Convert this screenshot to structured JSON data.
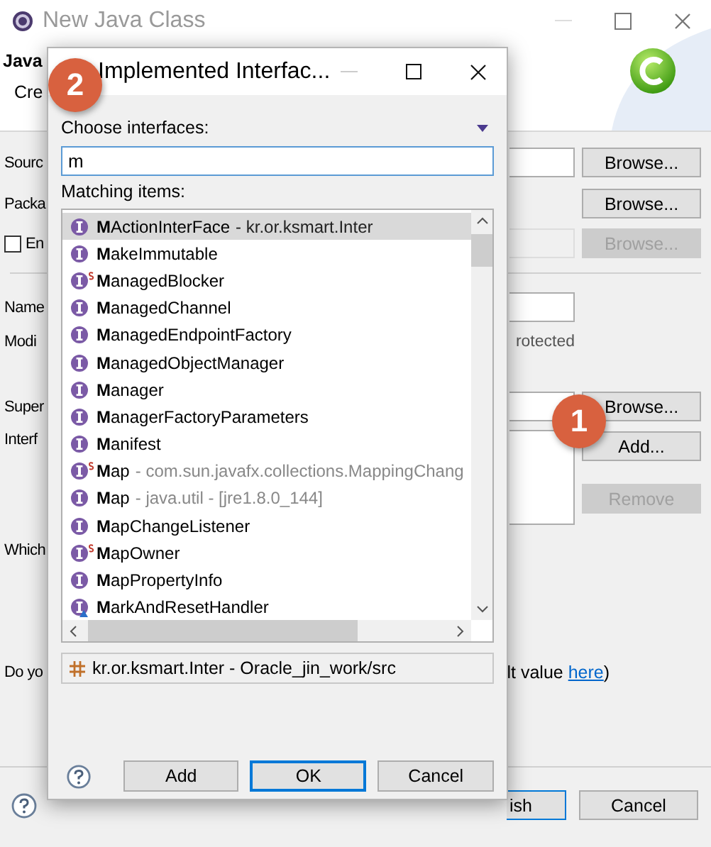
{
  "window": {
    "title": "New Java Class"
  },
  "header": {
    "title": "Java",
    "subtitle": "Cre"
  },
  "form": {
    "source_folder": {
      "label": "Sourc",
      "browse": {
        "label": "Browse...",
        "disabled": false
      }
    },
    "package": {
      "label": "Packa",
      "browse": {
        "label": "Browse...",
        "disabled": false
      }
    },
    "enclosing_type": {
      "label": "En",
      "checked": false,
      "browse": {
        "label": "Browse...",
        "disabled": true
      }
    },
    "name": {
      "label": "Name"
    },
    "modifiers": {
      "label": "Modi",
      "option": "rotected"
    },
    "superclass": {
      "label": "Super",
      "browse": {
        "label": "Browse...",
        "disabled": false
      }
    },
    "interfaces": {
      "label": "Interf",
      "add": {
        "label": "Add...",
        "disabled": false
      },
      "remove": {
        "label": "Remove",
        "disabled": true
      }
    },
    "stubs": {
      "label": "Which"
    },
    "comments": {
      "label": "Do yo",
      "text": "lt value",
      "link": "here",
      "after": ")"
    }
  },
  "footer": {
    "finish": "ish",
    "cancel": "Cancel"
  },
  "dialog": {
    "title": "Implemented Interfac...",
    "prompt": "Choose interfaces:",
    "filter": "m",
    "list_label": "Matching items:",
    "items": [
      {
        "name": "**M**ActionInterFace",
        "qualifier": "- kr.or.ksmart.Inter",
        "kind": "interface",
        "selected": true
      },
      {
        "name": "**M**akeImmutable",
        "kind": "interface",
        "selected": false
      },
      {
        "name": "**M**anagedBlocker",
        "kind": "static",
        "selected": false
      },
      {
        "name": "**M**anagedChannel",
        "kind": "interface",
        "selected": false
      },
      {
        "name": "**M**anagedEndpointFactory",
        "kind": "interface",
        "selected": false
      },
      {
        "name": "**M**anagedObjectManager",
        "kind": "interface",
        "selected": false
      },
      {
        "name": "**M**anager",
        "kind": "interface",
        "selected": false
      },
      {
        "name": "**M**anagerFactoryParameters",
        "kind": "interface",
        "selected": false
      },
      {
        "name": "**M**anifest",
        "kind": "interface",
        "selected": false
      },
      {
        "name": "**M**ap",
        "qualifier": "- com.sun.javafx.collections.MappingChang",
        "kind": "static",
        "selected": false
      },
      {
        "name": "**M**ap",
        "qualifier": "- java.util - [jre1.8.0_144]",
        "kind": "interface",
        "selected": false
      },
      {
        "name": "**M**apChangeListener",
        "kind": "interface",
        "selected": false
      },
      {
        "name": "**M**apOwner",
        "kind": "static",
        "selected": false
      },
      {
        "name": "**M**apPropertyInfo",
        "kind": "interface",
        "selected": false
      },
      {
        "name": "**M**arkAndResetHandler",
        "kind": "marked",
        "selected": false
      }
    ],
    "location": "kr.or.ksmart.Inter - Oracle_jin_work/src",
    "buttons": [
      {
        "label": "Add",
        "default": false
      },
      {
        "label": "OK",
        "default": true
      },
      {
        "label": "Cancel",
        "default": false
      }
    ]
  },
  "callouts": [
    {
      "label": "2"
    },
    {
      "label": "1"
    }
  ]
}
